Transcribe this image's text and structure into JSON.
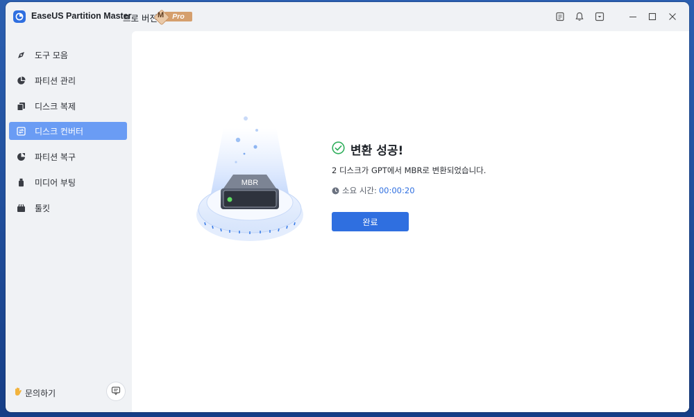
{
  "titlebar": {
    "app_name": "EaseUS Partition Master",
    "edition": "프로 버전",
    "badge_letter": "M",
    "badge_text": "Pro",
    "icons": [
      "notes-icon",
      "bell-icon",
      "dropdown-box-icon",
      "minimize-icon",
      "maximize-icon",
      "close-icon"
    ]
  },
  "sidebar": {
    "items": [
      {
        "label": "도구 모음",
        "icon": "compass-icon",
        "active": false
      },
      {
        "label": "파티션 관리",
        "icon": "pie-chart-icon",
        "active": false
      },
      {
        "label": "디스크 복제",
        "icon": "copy-icon",
        "active": false
      },
      {
        "label": "디스크 컨버터",
        "icon": "convert-icon",
        "active": true
      },
      {
        "label": "파티션 복구",
        "icon": "recovery-icon",
        "active": false
      },
      {
        "label": "미디어 부팅",
        "icon": "usb-icon",
        "active": false
      },
      {
        "label": "툴킷",
        "icon": "toolkit-icon",
        "active": false
      }
    ],
    "help_label": "문의하기",
    "feedback_icon": "chat-icon"
  },
  "main": {
    "disk_label": "MBR",
    "title": "변환 성공!",
    "description": "2 디스크가 GPT에서 MBR로 변환되었습니다.",
    "time_label": "소요 시간:",
    "time_value": "00:00:20",
    "done_button": "완료"
  },
  "colors": {
    "accent": "#2f6fe0",
    "sidebar_active": "#6a9cf4",
    "success": "#2fae5b"
  }
}
